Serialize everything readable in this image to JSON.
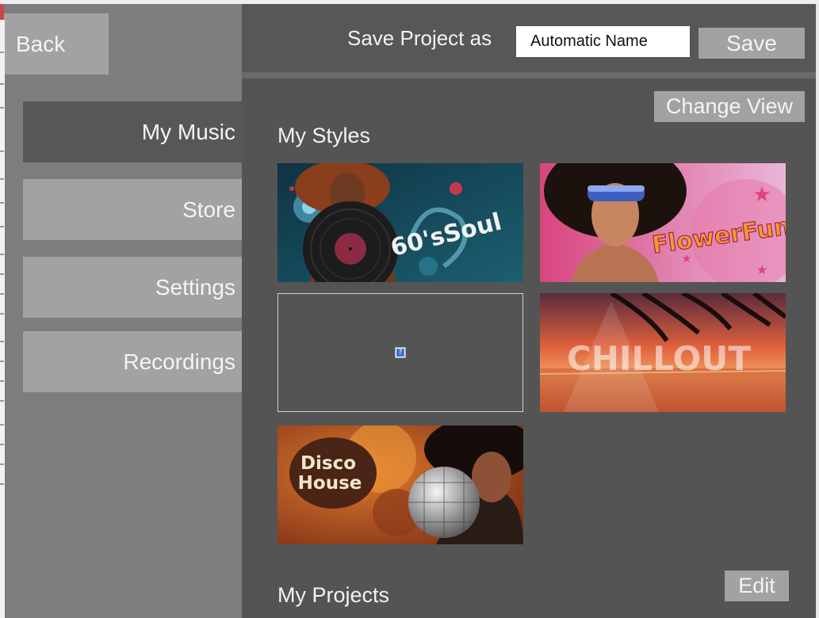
{
  "nav": {
    "back_label": "Back",
    "items": [
      {
        "label": "My Music",
        "active": true
      },
      {
        "label": "Store",
        "active": false
      },
      {
        "label": "Settings",
        "active": false
      },
      {
        "label": "Recordings",
        "active": false
      }
    ]
  },
  "header": {
    "save_project_label": "Save Project as",
    "project_name_value": "Automatic Name",
    "save_button": "Save"
  },
  "toolbar": {
    "change_view": "Change View"
  },
  "styles_section": {
    "title": "My Styles",
    "tiles": [
      {
        "name": "60's Soul",
        "label": "60'sSoul"
      },
      {
        "name": "Flower Funk",
        "label": "FlowerFunk"
      },
      {
        "name": "missing-image",
        "label": ""
      },
      {
        "name": "Chillout",
        "label": "CHILLOUT"
      },
      {
        "name": "Disco House",
        "label_line1": "Disco",
        "label_line2": "House"
      }
    ]
  },
  "projects_section": {
    "title": "My Projects",
    "edit_button": "Edit"
  },
  "colors": {
    "panel_dark": "#545454",
    "sidebar": "#7d7d7d",
    "button": "#a2a2a2",
    "active_nav": "#575757"
  }
}
